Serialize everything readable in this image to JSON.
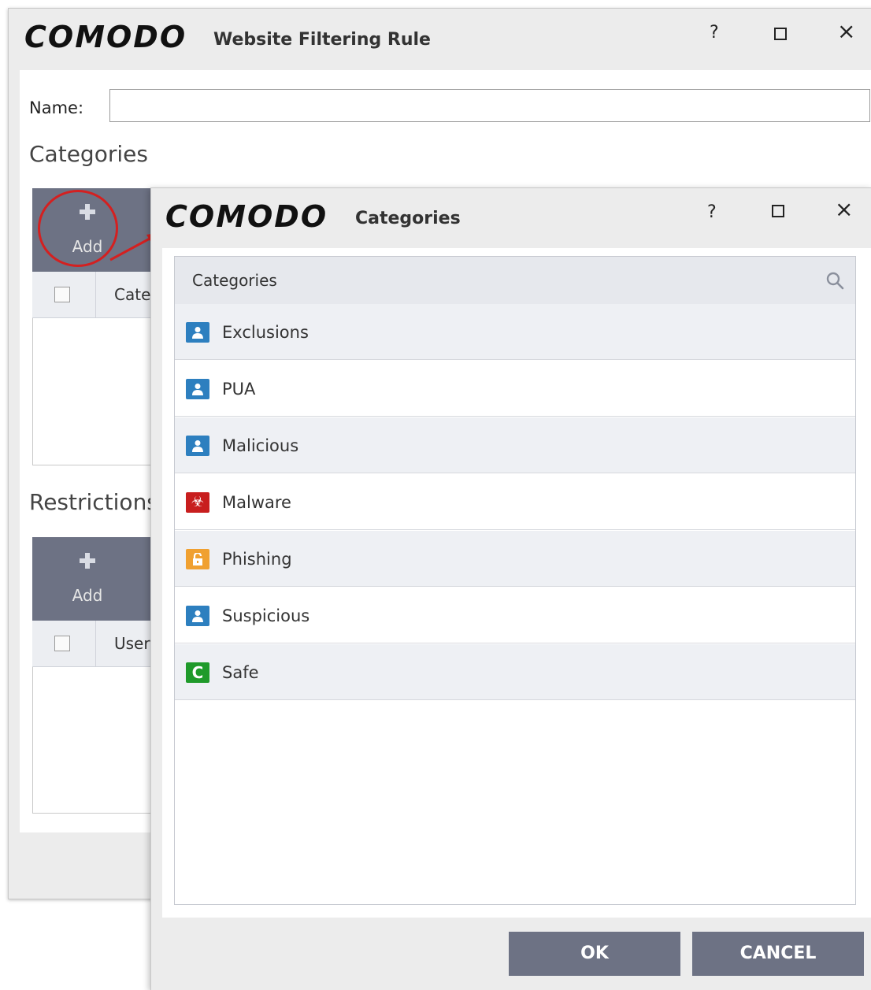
{
  "back_window": {
    "logo": "COMODO",
    "title": "Website Filtering Rule",
    "help": "?",
    "close": "×",
    "name_label": "Name:",
    "name_value": "",
    "categories_heading": "Categories",
    "restrictions_heading": "Restrictions",
    "add_label": "Add",
    "categories_col": "Cate",
    "users_col": "User"
  },
  "dialog": {
    "logo": "COMODO",
    "title": "Categories",
    "help": "?",
    "close": "×",
    "list_header": "Categories",
    "items": [
      {
        "label": "Exclusions",
        "icon": "user-badge-icon",
        "color": "#2d7fbf"
      },
      {
        "label": "PUA",
        "icon": "user-badge-icon",
        "color": "#2d7fbf"
      },
      {
        "label": "Malicious",
        "icon": "user-badge-icon",
        "color": "#2d7fbf"
      },
      {
        "label": "Malware",
        "icon": "biohazard-icon",
        "color": "#c81e1e"
      },
      {
        "label": "Phishing",
        "icon": "lock-icon",
        "color": "#f0a030"
      },
      {
        "label": "Suspicious",
        "icon": "user-badge-icon",
        "color": "#2d7fbf"
      },
      {
        "label": "Safe",
        "icon": "comodo-c-icon",
        "color": "#1f9a2a"
      }
    ],
    "ok_label": "OK",
    "cancel_label": "CANCEL"
  },
  "colors": {
    "toolbar": "#6d7284",
    "highlight": "#d42020",
    "button": "#6d7284"
  }
}
